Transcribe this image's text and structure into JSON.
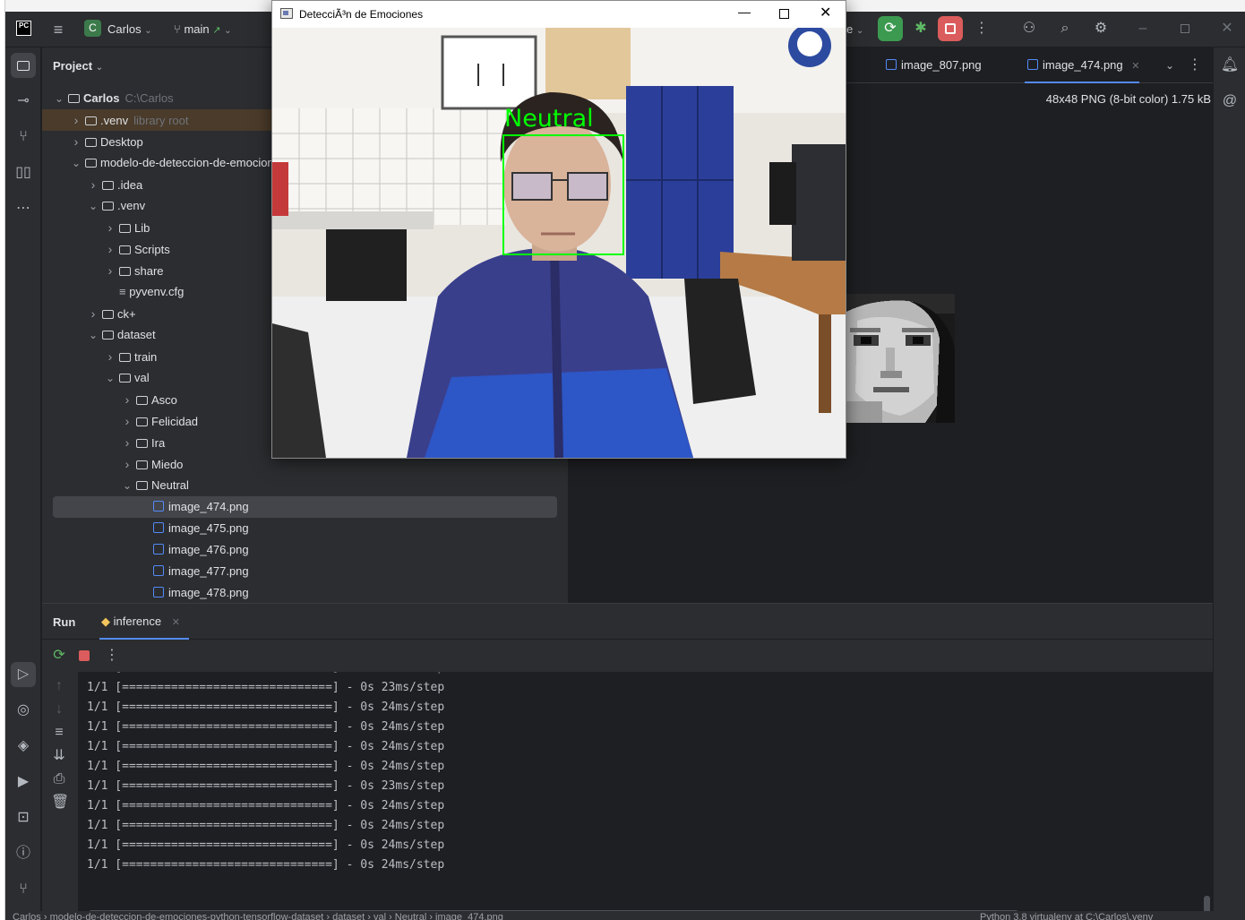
{
  "ide": {
    "project_name": "Carlos",
    "project_badge": "C",
    "branch": "main",
    "run_config_tail": "e",
    "panel_title": "Project"
  },
  "tree": [
    {
      "label": "Carlos",
      "extra": "C:\\Carlos",
      "kind": "folder",
      "depth": 0,
      "open": true,
      "bold": true
    },
    {
      "label": ".venv",
      "extra": "library root",
      "kind": "folder",
      "depth": 1,
      "open": false,
      "hl": true
    },
    {
      "label": "Desktop",
      "extra": "",
      "kind": "folder",
      "depth": 1,
      "open": false
    },
    {
      "label": "modelo-de-deteccion-de-emociones-python-tensorflow-dataset",
      "extra": "",
      "kind": "folder",
      "depth": 1,
      "open": true
    },
    {
      "label": ".idea",
      "extra": "",
      "kind": "folder",
      "depth": 2,
      "open": false
    },
    {
      "label": ".venv",
      "extra": "",
      "kind": "folder",
      "depth": 2,
      "open": true
    },
    {
      "label": "Lib",
      "extra": "",
      "kind": "folder",
      "depth": 3,
      "open": false
    },
    {
      "label": "Scripts",
      "extra": "",
      "kind": "folder",
      "depth": 3,
      "open": false
    },
    {
      "label": "share",
      "extra": "",
      "kind": "folder",
      "depth": 3,
      "open": false
    },
    {
      "label": "pyvenv.cfg",
      "extra": "",
      "kind": "cfg",
      "depth": 3
    },
    {
      "label": "ck+",
      "extra": "",
      "kind": "folder",
      "depth": 2,
      "open": false
    },
    {
      "label": "dataset",
      "extra": "",
      "kind": "folder",
      "depth": 2,
      "open": true
    },
    {
      "label": "train",
      "extra": "",
      "kind": "folder",
      "depth": 3,
      "open": false
    },
    {
      "label": "val",
      "extra": "",
      "kind": "folder",
      "depth": 3,
      "open": true
    },
    {
      "label": "Asco",
      "extra": "",
      "kind": "folder",
      "depth": 4,
      "open": false
    },
    {
      "label": "Felicidad",
      "extra": "",
      "kind": "folder",
      "depth": 4,
      "open": false
    },
    {
      "label": "Ira",
      "extra": "",
      "kind": "folder",
      "depth": 4,
      "open": false
    },
    {
      "label": "Miedo",
      "extra": "",
      "kind": "folder",
      "depth": 4,
      "open": false
    },
    {
      "label": "Neutral",
      "extra": "",
      "kind": "folder",
      "depth": 4,
      "open": true
    },
    {
      "label": "image_474.png",
      "extra": "",
      "kind": "png",
      "depth": 5,
      "selected": true
    },
    {
      "label": "image_475.png",
      "extra": "",
      "kind": "png",
      "depth": 5
    },
    {
      "label": "image_476.png",
      "extra": "",
      "kind": "png",
      "depth": 5
    },
    {
      "label": "image_477.png",
      "extra": "",
      "kind": "png",
      "depth": 5
    },
    {
      "label": "image_478.png",
      "extra": "",
      "kind": "png",
      "depth": 5
    }
  ],
  "editor": {
    "tab1": "image_807.png",
    "tab2": "image_474.png",
    "image_info": "48x48 PNG (8-bit color) 1.75 kB"
  },
  "run": {
    "title": "Run",
    "tab": "inference",
    "lines": [
      "1/1 [==============================] - 0s 23ms/step",
      "1/1 [==============================] - 0s 24ms/step",
      "1/1 [==============================] - 0s 24ms/step",
      "1/1 [==============================] - 0s 24ms/step",
      "1/1 [==============================] - 0s 24ms/step",
      "1/1 [==============================] - 0s 23ms/step",
      "1/1 [==============================] - 0s 24ms/step",
      "1/1 [==============================] - 0s 24ms/step",
      "1/1 [==============================] - 0s 24ms/step",
      "1/1 [==============================] - 0s 24ms/step"
    ]
  },
  "status": {
    "crumbs": [
      "Carlos",
      "modelo-de-deteccion-de-emociones-python-tensorflow-dataset",
      "dataset",
      "val",
      "Neutral",
      "image_474.png"
    ],
    "interpreter": "Python 3.8 virtualenv at C:\\Carlos\\.venv"
  },
  "cv": {
    "title": "DetecciÃ³n de Emociones",
    "label": "Neutral",
    "label_color": "#00ff00"
  },
  "colors": {
    "accent": "#548af7",
    "run_green": "#3c9a50",
    "stop_red": "#db5c5c",
    "selection": "#43454a"
  }
}
